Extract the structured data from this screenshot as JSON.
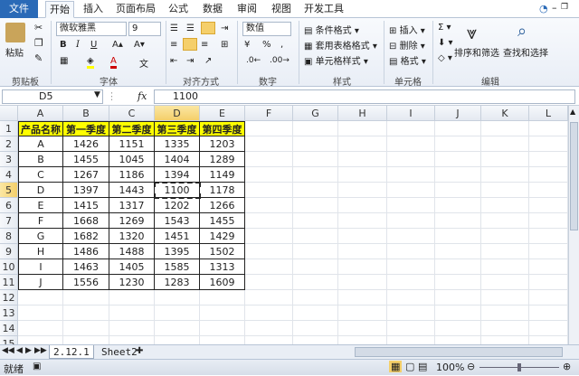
{
  "tabs": [
    "文件",
    "开始",
    "插入",
    "页面布局",
    "公式",
    "数据",
    "审阅",
    "视图",
    "开发工具"
  ],
  "ribbon": {
    "clipboard": {
      "paste": "粘贴",
      "label": "剪贴板"
    },
    "font": {
      "name": "微软雅黑",
      "size": "9",
      "label": "字体"
    },
    "alignment": {
      "label": "对齐方式"
    },
    "number": {
      "format": "数值",
      "label": "数字"
    },
    "styles": {
      "conditional": "条件格式",
      "table": "套用表格格式",
      "cell": "单元格样式",
      "label": "样式"
    },
    "cells": {
      "insert": "插入",
      "delete": "删除",
      "format": "格式",
      "label": "单元格"
    },
    "editing": {
      "sort": "排序和筛选",
      "find": "查找和选择",
      "label": "编辑"
    }
  },
  "formula_bar": {
    "name_box": "D5",
    "fx": "fx",
    "content": "1100"
  },
  "columns": [
    "A",
    "B",
    "C",
    "D",
    "E",
    "F",
    "G",
    "H",
    "I",
    "J",
    "K",
    "L"
  ],
  "rows": [
    "1",
    "2",
    "3",
    "4",
    "5",
    "6",
    "7",
    "8",
    "9",
    "10",
    "11",
    "12",
    "13",
    "14",
    "15"
  ],
  "table": {
    "headers": [
      "产品名称",
      "第一季度",
      "第二季度",
      "第三季度",
      "第四季度"
    ],
    "rows": [
      [
        "A",
        "1426",
        "1151",
        "1335",
        "1203"
      ],
      [
        "B",
        "1455",
        "1045",
        "1404",
        "1289"
      ],
      [
        "C",
        "1267",
        "1186",
        "1394",
        "1149"
      ],
      [
        "D",
        "1397",
        "1443",
        "1100",
        "1178"
      ],
      [
        "E",
        "1415",
        "1317",
        "1202",
        "1266"
      ],
      [
        "F",
        "1668",
        "1269",
        "1543",
        "1455"
      ],
      [
        "G",
        "1682",
        "1320",
        "1451",
        "1429"
      ],
      [
        "H",
        "1486",
        "1488",
        "1395",
        "1502"
      ],
      [
        "I",
        "1463",
        "1405",
        "1585",
        "1313"
      ],
      [
        "J",
        "1556",
        "1230",
        "1283",
        "1609"
      ]
    ]
  },
  "sheets": [
    "2.12.1",
    "Sheet2"
  ],
  "status": {
    "ready": "就绪",
    "zoom": "100%"
  },
  "colors": {
    "header_fill": "#ffff00",
    "selection": "#f4cf6a",
    "file_tab": "#2a6ab7"
  }
}
